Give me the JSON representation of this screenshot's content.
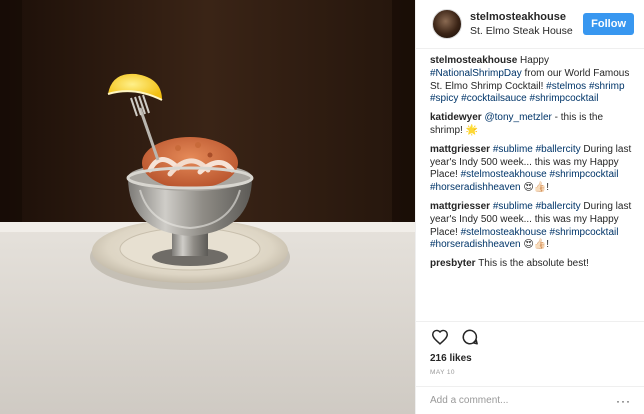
{
  "post": {
    "header": {
      "username": "stelmosteakhouse",
      "location": "St. Elmo Steak House",
      "follow_label": "Follow"
    },
    "comments": [
      {
        "user": "stelmosteakhouse",
        "parts": [
          {
            "t": "Happy ",
            "tag": false
          },
          {
            "t": "#NationalShrimpDay",
            "tag": true
          },
          {
            "t": " from our World Famous St. Elmo Shrimp Cocktail! ",
            "tag": false
          },
          {
            "t": "#stelmos",
            "tag": true
          },
          {
            "t": " ",
            "tag": false
          },
          {
            "t": "#shrimp",
            "tag": true
          },
          {
            "t": " ",
            "tag": false
          },
          {
            "t": "#spicy",
            "tag": true
          },
          {
            "t": " ",
            "tag": false
          },
          {
            "t": "#cocktailsauce",
            "tag": true
          },
          {
            "t": " ",
            "tag": false
          },
          {
            "t": "#shrimpcocktail",
            "tag": true
          }
        ]
      },
      {
        "user": "katidewyer",
        "parts": [
          {
            "t": "@tony_metzler",
            "tag": true
          },
          {
            "t": " - this is the shrimp! 🌟",
            "tag": false
          }
        ]
      },
      {
        "user": "mattgriesser",
        "parts": [
          {
            "t": "#sublime",
            "tag": true
          },
          {
            "t": " ",
            "tag": false
          },
          {
            "t": "#ballercity",
            "tag": true
          },
          {
            "t": " During last year's Indy 500 week... this was my Happy Place! ",
            "tag": false
          },
          {
            "t": "#stelmosteakhouse",
            "tag": true
          },
          {
            "t": " ",
            "tag": false
          },
          {
            "t": "#shrimpcocktail",
            "tag": true
          },
          {
            "t": " ",
            "tag": false
          },
          {
            "t": "#horseradishheaven",
            "tag": true
          },
          {
            "t": " 😍👍🏻!",
            "tag": false
          }
        ]
      },
      {
        "user": "mattgriesser",
        "parts": [
          {
            "t": "#sublime",
            "tag": true
          },
          {
            "t": " ",
            "tag": false
          },
          {
            "t": "#ballercity",
            "tag": true
          },
          {
            "t": " During last year's Indy 500 week... this was my Happy Place! ",
            "tag": false
          },
          {
            "t": "#stelmosteakhouse",
            "tag": true
          },
          {
            "t": " ",
            "tag": false
          },
          {
            "t": "#shrimpcocktail",
            "tag": true
          },
          {
            "t": " ",
            "tag": false
          },
          {
            "t": "#horseradishheaven",
            "tag": true
          },
          {
            "t": " 😍👍🏻!",
            "tag": false
          }
        ]
      },
      {
        "user": "presbyter",
        "parts": [
          {
            "t": "This is the absolute best!",
            "tag": false
          }
        ]
      }
    ],
    "actions": {
      "like_icon": "heart-icon",
      "comment_icon": "comment-bubble-icon",
      "likes": "216 likes",
      "date": "MAY 10"
    },
    "add_comment": {
      "placeholder": "Add a comment...",
      "more_label": "···"
    }
  },
  "colors": {
    "follow_button": "#3897f0",
    "hashtag": "#003569",
    "text": "#262626",
    "muted": "#999999"
  }
}
